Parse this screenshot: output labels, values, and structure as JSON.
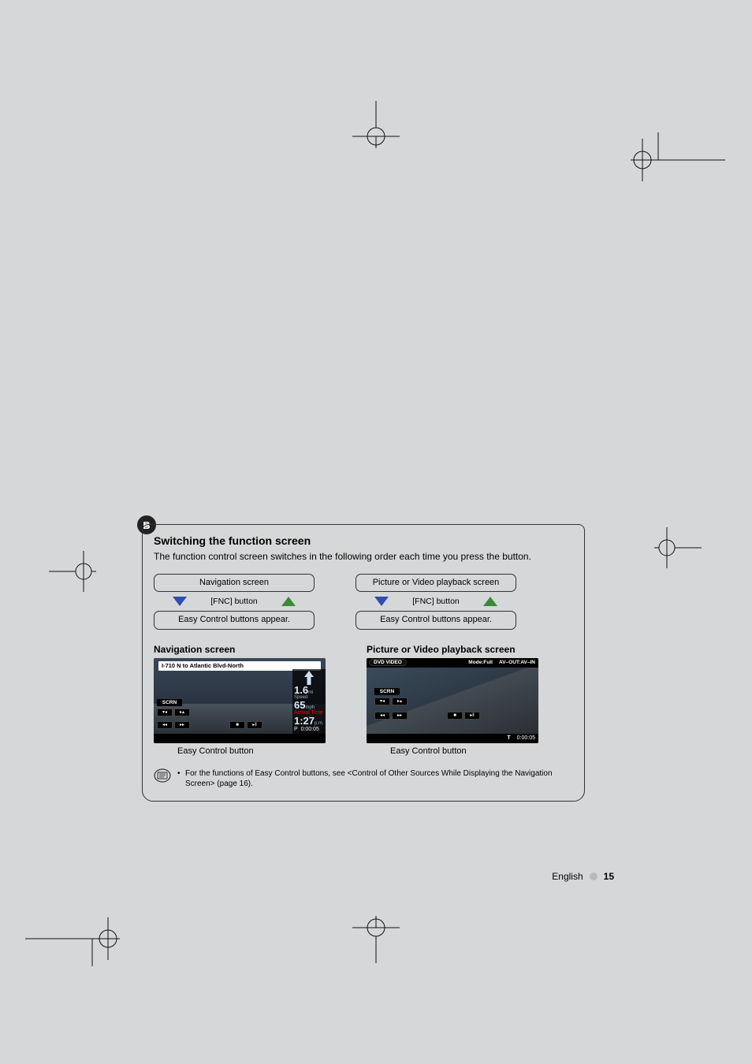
{
  "badge": "B",
  "section_title": "Switching the function screen",
  "intro": "The function control screen switches in the following order each time you press the button.",
  "flows": [
    {
      "top": "Navigation screen",
      "mid": "[FNC] button",
      "bottom": "Easy Control buttons appear."
    },
    {
      "top": "Picture or Video playback screen",
      "mid": "[FNC] button",
      "bottom": "Easy Control buttons appear."
    }
  ],
  "shots": {
    "nav": {
      "title": "Navigation screen",
      "topbar": "I-710 N to Atlantic Blvd-North",
      "scrn": "SCRN",
      "side": {
        "dist": "1.6",
        "dist_unit": "mi",
        "speed_label": "Speed",
        "speed": "65",
        "speed_unit": "mph",
        "arrival_label": "Arrival Time",
        "arrival": "1:27",
        "arrival_unit": "p.m.",
        "p": "P",
        "time": "0:00:05"
      },
      "easy_label": "Easy Control button"
    },
    "video": {
      "title": "Picture or Video playback screen",
      "dvd": "DVD VIDEO",
      "mode": "Mode:Full",
      "avout": "AV–OUT:AV–IN",
      "scrn": "SCRN",
      "t_label": "T",
      "time": "0:00:05",
      "easy_label": "Easy Control button"
    }
  },
  "note": "For the functions of Easy Control buttons, see <Control of Other Sources While Displaying the Navigation Screen> (page 16).",
  "footer": {
    "lang": "English",
    "page": "15"
  }
}
